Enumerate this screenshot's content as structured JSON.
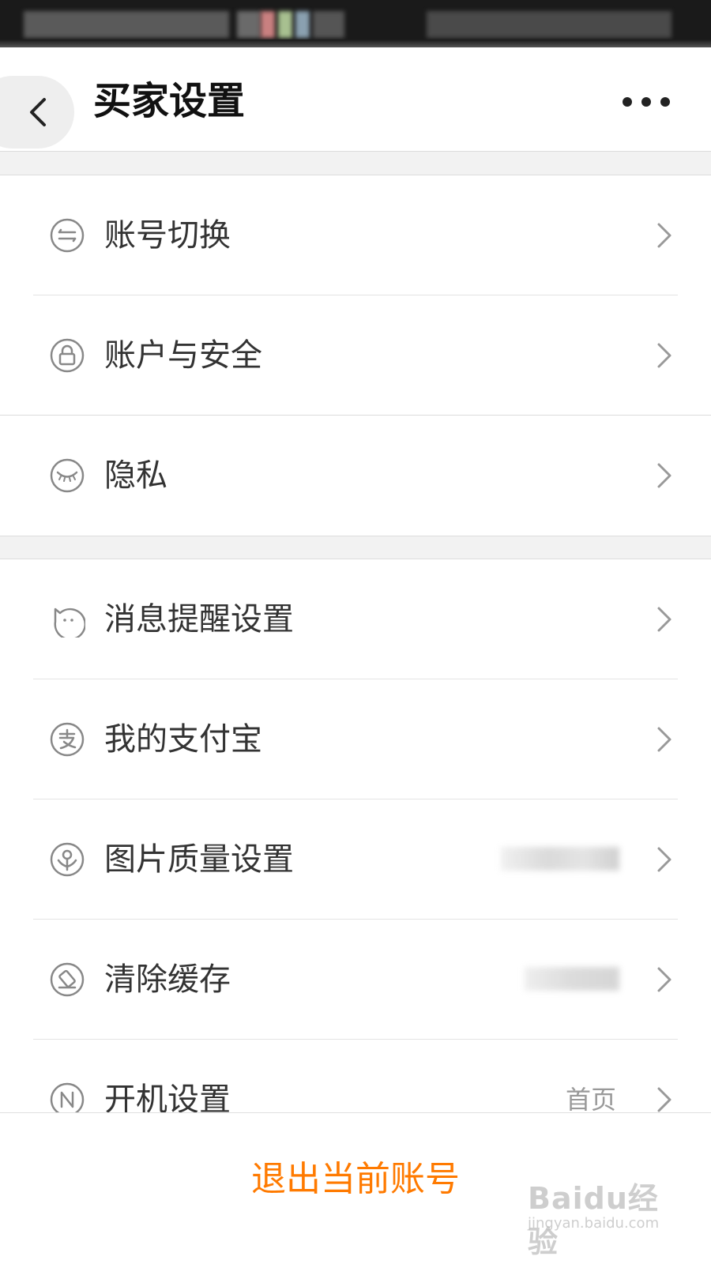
{
  "header": {
    "title": "买家设置",
    "back_icon": "chevron-left-icon",
    "more_icon": "more-dots-icon"
  },
  "sections": [
    {
      "items": [
        {
          "label": "账号切换",
          "icon": "switch-account-icon",
          "value": ""
        },
        {
          "label": "账户与安全",
          "icon": "lock-icon",
          "value": ""
        },
        {
          "label": "隐私",
          "icon": "eye-closed-icon",
          "value": ""
        }
      ]
    },
    {
      "items": [
        {
          "label": "消息提醒设置",
          "icon": "message-cat-icon",
          "value": ""
        },
        {
          "label": "我的支付宝",
          "icon": "alipay-icon",
          "value": ""
        },
        {
          "label": "图片质量设置",
          "icon": "image-quality-icon",
          "value": ""
        },
        {
          "label": "清除缓存",
          "icon": "clear-cache-icon",
          "value": ""
        },
        {
          "label": "开机设置",
          "icon": "startup-icon",
          "value": "首页"
        }
      ]
    }
  ],
  "footer": {
    "logout_label": "退出当前账号"
  },
  "watermark": {
    "brand": "Baidu经验",
    "url": "jingyan.baidu.com"
  },
  "colors": {
    "accent": "#ff7a00",
    "label": "#333333",
    "value": "#999999",
    "divider": "#e4e4e4",
    "section_gap": "#f2f2f2"
  }
}
